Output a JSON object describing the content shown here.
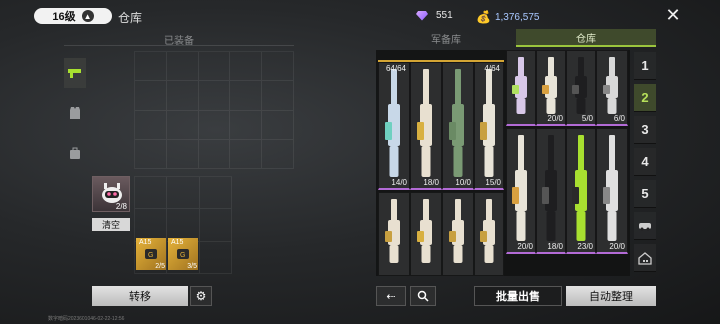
{
  "header": {
    "level": "16级",
    "title": "仓库",
    "gems": "551",
    "coins": "1,376,575"
  },
  "equipped": {
    "label": "已装备",
    "pet_count": "2/8",
    "clear_label": "清空",
    "ammo": [
      {
        "label": "A15",
        "count": "2/5"
      },
      {
        "label": "A15",
        "count": "3/5"
      }
    ],
    "transfer_label": "转移"
  },
  "storage": {
    "tabs": [
      "军备库",
      "仓库"
    ],
    "active_tab": "仓库",
    "weapons": [
      {
        "top": "64/64",
        "count": "14/0",
        "color": "#c8d8e8",
        "accent": "#6fd0c0",
        "rarity": "purple"
      },
      {
        "top": "",
        "count": "18/0",
        "color": "#e8e0d0",
        "accent": "#d8b040",
        "rarity": "purple"
      },
      {
        "top": "",
        "count": "10/0",
        "color": "#7a9a74",
        "accent": "#6a8a64",
        "rarity": "purple"
      },
      {
        "top": "4/64",
        "count": "15/0",
        "color": "#e8e4d8",
        "accent": "#c8a040",
        "rarity": "purple"
      },
      {
        "top": "",
        "count": "",
        "color": "#d8c8e8",
        "accent": "#b0e060",
        "rarity": "purple"
      },
      {
        "top": "",
        "count": "20/0",
        "color": "#e8e4d8",
        "accent": "#d8a040",
        "rarity": "purple"
      },
      {
        "top": "",
        "count": "5/0",
        "color": "#1e1e20",
        "accent": "#555",
        "rarity": "purple"
      },
      {
        "top": "",
        "count": "6/0",
        "color": "#d8d8d8",
        "accent": "#888",
        "rarity": "purple"
      },
      {
        "top": "",
        "count": "",
        "color": "#e8e0d0",
        "accent": "#c8a040",
        "rarity": "none"
      },
      {
        "top": "",
        "count": "",
        "color": "#e8e0d0",
        "accent": "#d8b040",
        "rarity": "none"
      },
      {
        "top": "",
        "count": "",
        "color": "#e8e0d0",
        "accent": "#c8a040",
        "rarity": "none"
      },
      {
        "top": "",
        "count": "",
        "color": "#e8e0d0",
        "accent": "#c8a040",
        "rarity": "none"
      },
      {
        "top": "",
        "count": "20/0",
        "color": "#e8e4d8",
        "accent": "#d8a040",
        "rarity": "purple"
      },
      {
        "top": "",
        "count": "18/0",
        "color": "#1e1e20",
        "accent": "#555",
        "rarity": "purple"
      },
      {
        "top": "",
        "count": "23/0",
        "color": "#a8e030",
        "accent": "#2a2a2a",
        "rarity": "purple"
      },
      {
        "top": "",
        "count": "20/0",
        "color": "#e0e0e0",
        "accent": "#888",
        "rarity": "purple"
      }
    ],
    "pages": [
      "1",
      "2",
      "3",
      "4",
      "5"
    ],
    "active_page": "2",
    "bulk_sell_label": "批量出售",
    "auto_sort_label": "自动整理"
  },
  "footer": {
    "text": "数字暗码2023601046-02-22-12:56"
  },
  "colors": {
    "accent_green": "#9bc53d",
    "purple": "#b36bd6",
    "gold": "#d4a534"
  }
}
